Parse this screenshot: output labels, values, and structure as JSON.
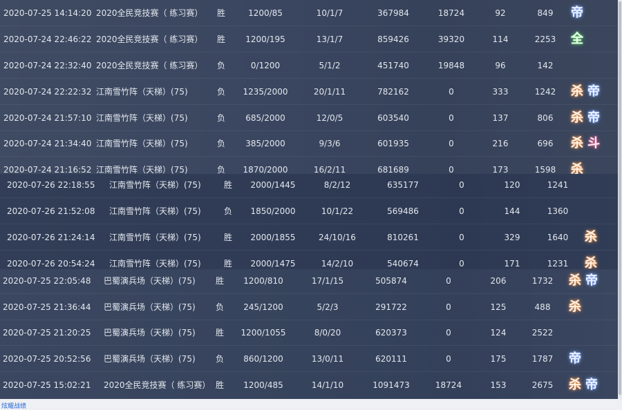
{
  "blocks": [
    {
      "rows": [
        {
          "time": "2020-07-25 14:14:20",
          "map": "2020全民竞技赛（ 练习赛）",
          "result": "胜",
          "score": "1200/85",
          "kda": "10/1/7",
          "damage": "367984",
          "heal": "18724",
          "v1": "92",
          "v2": "849",
          "badges": [
            "emp"
          ]
        },
        {
          "time": "2020-07-24 22:46:22",
          "map": "2020全民竞技赛（ 练习赛）",
          "result": "胜",
          "score": "1200/195",
          "kda": "13/1/7",
          "damage": "859426",
          "heal": "39320",
          "v1": "114",
          "v2": "2253",
          "badges": [
            "all"
          ]
        },
        {
          "time": "2020-07-24 22:32:40",
          "map": "2020全民竞技赛（ 练习赛）",
          "result": "负",
          "score": "0/1200",
          "kda": "5/1/2",
          "damage": "451740",
          "heal": "19848",
          "v1": "96",
          "v2": "142",
          "badges": []
        },
        {
          "time": "2020-07-24 22:22:32",
          "map": "江南雪竹阵（天梯）(75)",
          "result": "负",
          "score": "1235/2000",
          "kda": "20/1/11",
          "damage": "782162",
          "heal": "0",
          "v1": "333",
          "v2": "1242",
          "badges": [
            "kill",
            "emp"
          ]
        },
        {
          "time": "2020-07-24 21:57:10",
          "map": "江南雪竹阵（天梯）(75)",
          "result": "负",
          "score": "685/2000",
          "kda": "12/0/5",
          "damage": "603540",
          "heal": "0",
          "v1": "137",
          "v2": "806",
          "badges": [
            "kill",
            "emp"
          ]
        },
        {
          "time": "2020-07-24 21:34:40",
          "map": "江南雪竹阵（天梯）(75)",
          "result": "负",
          "score": "385/2000",
          "kda": "9/3/6",
          "damage": "601935",
          "heal": "0",
          "v1": "216",
          "v2": "696",
          "badges": [
            "kill",
            "dou"
          ]
        },
        {
          "time": "2020-07-24 21:16:52",
          "map": "江南雪竹阵（天梯）(75)",
          "result": "负",
          "score": "1870/2000",
          "kda": "16/2/11",
          "damage": "681689",
          "heal": "0",
          "v1": "173",
          "v2": "1598",
          "badges": [
            "kill"
          ]
        }
      ]
    },
    {
      "rows": [
        {
          "time": "2020-07-26 22:18:55",
          "map": "江南雪竹阵（天梯）(75)",
          "result": "胜",
          "score": "2000/1445",
          "kda": "8/2/12",
          "damage": "635177",
          "heal": "0",
          "v1": "120",
          "v2": "1241",
          "badges": []
        },
        {
          "time": "2020-07-26 21:52:08",
          "map": "江南雪竹阵（天梯）(75)",
          "result": "负",
          "score": "1850/2000",
          "kda": "10/1/22",
          "damage": "569486",
          "heal": "0",
          "v1": "144",
          "v2": "1360",
          "badges": []
        },
        {
          "time": "2020-07-26 21:24:14",
          "map": "江南雪竹阵（天梯）(75)",
          "result": "胜",
          "score": "2000/1855",
          "kda": "24/10/16",
          "damage": "810261",
          "heal": "0",
          "v1": "329",
          "v2": "1640",
          "badges": [
            "kill"
          ]
        },
        {
          "time": "2020-07-26 20:54:24",
          "map": "江南雪竹阵（天梯）(75)",
          "result": "胜",
          "score": "2000/1475",
          "kda": "14/2/10",
          "damage": "540674",
          "heal": "0",
          "v1": "171",
          "v2": "1231",
          "badges": [
            "kill"
          ]
        }
      ]
    },
    {
      "rows": [
        {
          "time": "2020-07-25 22:05:48",
          "map": "巴蜀演兵场（天梯）(75)",
          "result": "胜",
          "score": "1200/810",
          "kda": "17/1/15",
          "damage": "505874",
          "heal": "0",
          "v1": "206",
          "v2": "1732",
          "badges": [
            "kill",
            "emp"
          ]
        },
        {
          "time": "2020-07-25 21:36:44",
          "map": "巴蜀演兵场（天梯）(75)",
          "result": "负",
          "score": "245/1200",
          "kda": "5/2/3",
          "damage": "291722",
          "heal": "0",
          "v1": "125",
          "v2": "488",
          "badges": [
            "kill"
          ]
        },
        {
          "time": "2020-07-25 21:20:25",
          "map": "巴蜀演兵场（天梯）(75)",
          "result": "胜",
          "score": "1200/1055",
          "kda": "8/0/20",
          "damage": "620373",
          "heal": "0",
          "v1": "124",
          "v2": "2522",
          "badges": []
        },
        {
          "time": "2020-07-25 20:52:56",
          "map": "巴蜀演兵场（天梯）(75)",
          "result": "负",
          "score": "860/1200",
          "kda": "13/0/11",
          "damage": "620111",
          "heal": "0",
          "v1": "175",
          "v2": "1787",
          "badges": [
            "emp"
          ]
        },
        {
          "time": "2020-07-25 15:02:21",
          "map": "2020全民竞技赛（ 练习赛）",
          "result": "胜",
          "score": "1200/485",
          "kda": "14/1/10",
          "damage": "1091473",
          "heal": "18724",
          "v1": "153",
          "v2": "2675",
          "badges": [
            "kill",
            "emp"
          ]
        }
      ]
    }
  ],
  "badge_glyphs": {
    "kill": "杀",
    "emp": "帝",
    "dou": "斗",
    "all": "全"
  },
  "footer_link_text": "炫耀战绩"
}
